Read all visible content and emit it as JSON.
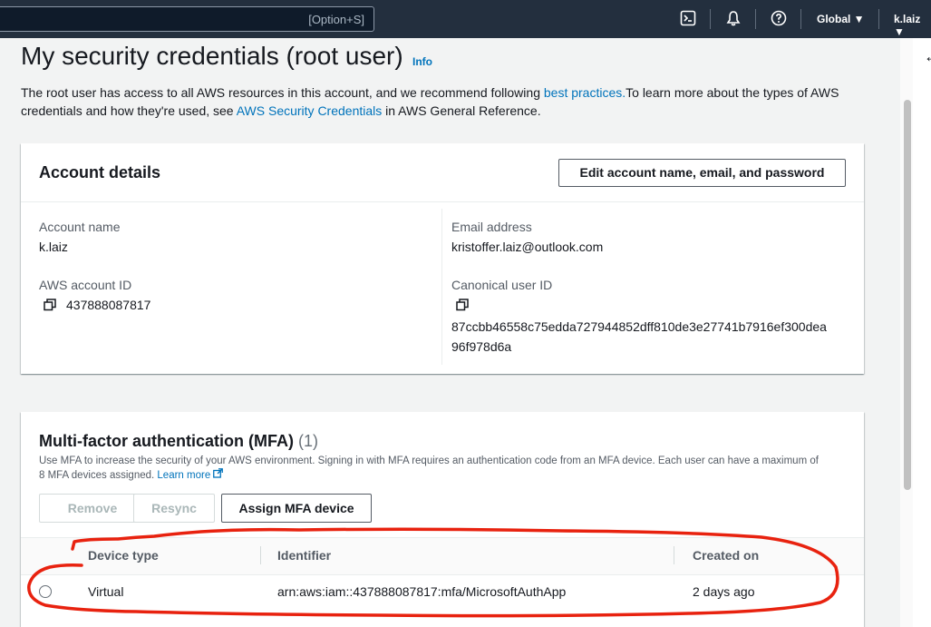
{
  "topbar": {
    "search_hint": "[Option+S]",
    "region_label": "Global ▼",
    "user_label": "k.laiz ▼",
    "icons": [
      "cloudshell-icon",
      "notifications-bell-icon",
      "help-icon"
    ]
  },
  "page": {
    "title": "My security credentials (root user)",
    "info_link": "Info",
    "intro_part1": "The root user has access to all AWS resources in this account, and we recommend following ",
    "intro_link1": "best practices.",
    "intro_part2": "To learn more about the types of AWS credentials and how they're used, see ",
    "intro_link2": "AWS Security Credentials",
    "intro_part3": " in AWS General Reference."
  },
  "account_details": {
    "title": "Account details",
    "edit_button": "Edit account name, email, and password",
    "account_name_label": "Account name",
    "account_name_value": "k.laiz",
    "account_id_label": "AWS account ID",
    "account_id_value": "437888087817",
    "email_label": "Email address",
    "email_value": "kristoffer.laiz@outlook.com",
    "canonical_label": "Canonical user ID",
    "canonical_line1": "87ccbb46558c75edda727944852dff810de3e27741b7916ef300dea",
    "canonical_line2": "96f978d6a"
  },
  "mfa": {
    "title": "Multi-factor authentication (MFA)",
    "count": "(1)",
    "description": "Use MFA to increase the security of your AWS environment. Signing in with MFA requires an authentication code from an MFA device. Each user can have a maximum of 8 MFA devices assigned. ",
    "learn_more": "Learn more",
    "remove_button": "Remove",
    "resync_button": "Resync",
    "assign_button": "Assign MFA device",
    "columns": [
      "Device type",
      "Identifier",
      "Created on"
    ],
    "rows": [
      {
        "device_type": "Virtual",
        "identifier": "arn:aws:iam::437888087817:mfa/MicrosoftAuthApp",
        "created_on": "2 days ago"
      }
    ]
  },
  "colors": {
    "topbar": "#232f3e",
    "link": "#0073bb",
    "annotation": "#e8220f"
  }
}
